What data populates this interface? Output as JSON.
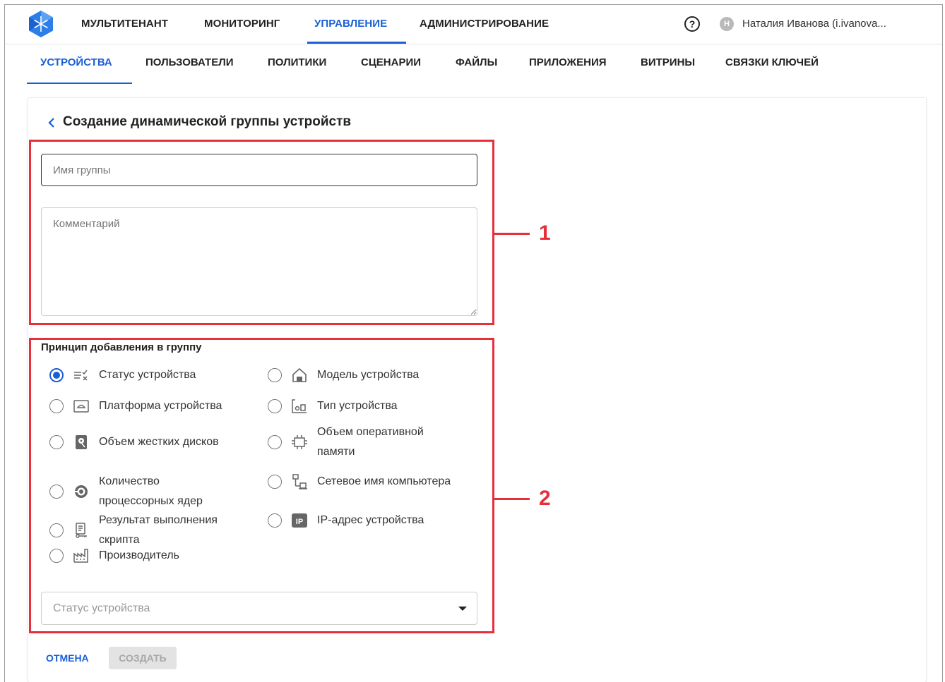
{
  "topnav": {
    "items": [
      {
        "label": "МУЛЬТИТЕНАНТ"
      },
      {
        "label": "МОНИТОРИНГ"
      },
      {
        "label": "УПРАВЛЕНИЕ"
      },
      {
        "label": "АДМИНИСТРИРОВАНИЕ"
      }
    ],
    "active": "УПРАВЛЕНИЕ",
    "help_icon": "?",
    "user": {
      "initial": "Н",
      "name": "Наталия Иванова (i.ivanova..."
    }
  },
  "subnav": {
    "items": [
      {
        "label": "УСТРОЙСТВА"
      },
      {
        "label": "ПОЛЬЗОВАТЕЛИ"
      },
      {
        "label": "ПОЛИТИКИ"
      },
      {
        "label": "СЦЕНАРИИ"
      },
      {
        "label": "ФАЙЛЫ"
      },
      {
        "label": "ПРИЛОЖЕНИЯ"
      },
      {
        "label": "ВИТРИНЫ"
      },
      {
        "label": "СВЯЗКИ КЛЮЧЕЙ"
      }
    ],
    "active": "УСТРОЙСТВА"
  },
  "page": {
    "title": "Создание динамической группы устройств",
    "group_name_placeholder": "Имя группы",
    "comment_placeholder": "Комментарий",
    "section_label": "Принцип добавления в группу",
    "options_left": [
      {
        "label": "Статус устройства",
        "icon": "status-icon",
        "checked": true
      },
      {
        "label": "Платформа устройства",
        "icon": "platform-icon",
        "checked": false
      },
      {
        "label": "Объем жестких дисков",
        "icon": "hdd-icon",
        "checked": false
      },
      {
        "label": "Количество процессорных ядер",
        "icon": "cpu-icon",
        "checked": false
      },
      {
        "label": "Результат выполнения скрипта",
        "icon": "script-icon",
        "checked": false
      },
      {
        "label": "Производитель",
        "icon": "factory-icon",
        "checked": false
      }
    ],
    "options_right": [
      {
        "label": "Модель устройства",
        "icon": "model-icon",
        "checked": false
      },
      {
        "label": "Тип устройства",
        "icon": "device-type-icon",
        "checked": false
      },
      {
        "label": "Объем оперативной памяти",
        "icon": "ram-icon",
        "checked": false
      },
      {
        "label": "Сетевое имя компьютера",
        "icon": "network-icon",
        "checked": false
      },
      {
        "label": "IP-адрес устройства",
        "icon": "ip-icon",
        "checked": false
      }
    ],
    "select_placeholder": "Статус устройства",
    "cancel_label": "ОТМЕНА",
    "create_label": "СОЗДАТЬ"
  },
  "annotations": {
    "first": "1",
    "second": "2"
  },
  "colors": {
    "accent": "#1a5fd6",
    "highlight": "#e5303b"
  }
}
